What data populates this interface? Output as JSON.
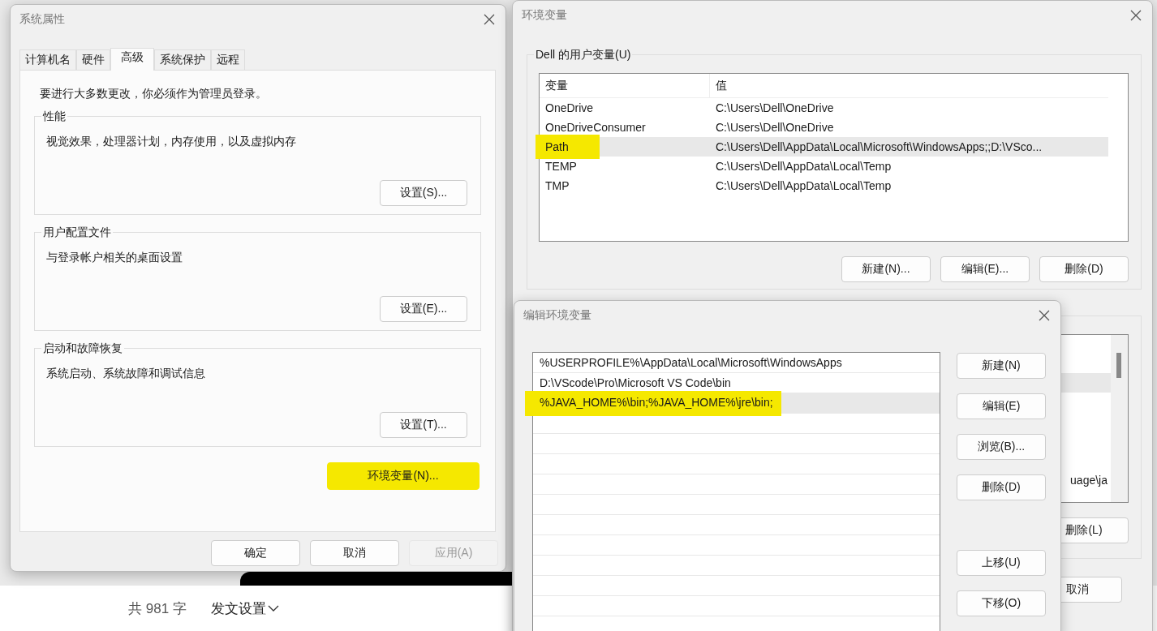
{
  "page_footer": {
    "word_count": "共 981 字",
    "publish_settings": "发文设置"
  },
  "system_properties": {
    "title": "系统属性",
    "tabs": [
      {
        "label": "计算机名",
        "selected": false
      },
      {
        "label": "硬件",
        "selected": false
      },
      {
        "label": "高级",
        "selected": true
      },
      {
        "label": "系统保护",
        "selected": false
      },
      {
        "label": "远程",
        "selected": false
      }
    ],
    "admin_note": "要进行大多数更改，你必须作为管理员登录。",
    "groups": [
      {
        "title": "性能",
        "description": "视觉效果，处理器计划，内存使用，以及虚拟内存",
        "button": "设置(S)..."
      },
      {
        "title": "用户配置文件",
        "description": "与登录帐户相关的桌面设置",
        "button": "设置(E)..."
      },
      {
        "title": "启动和故障恢复",
        "description": "系统启动、系统故障和调试信息",
        "button": "设置(T)..."
      }
    ],
    "env_button": {
      "label": "环境变量(N)...",
      "highlighted": true
    },
    "buttons": [
      {
        "label": "确定",
        "disabled": false
      },
      {
        "label": "取消",
        "disabled": false
      },
      {
        "label": "应用(A)",
        "disabled": true
      }
    ]
  },
  "environment_variables": {
    "title": "环境变量",
    "user_group": "Dell 的用户变量(U)",
    "columns": [
      "变量",
      "值"
    ],
    "rows": [
      {
        "name": "OneDrive",
        "value": "C:\\Users\\Dell\\OneDrive",
        "selected": false,
        "highlighted": false
      },
      {
        "name": "OneDriveConsumer",
        "value": "C:\\Users\\Dell\\OneDrive",
        "selected": false,
        "highlighted": false
      },
      {
        "name": "Path",
        "value": "C:\\Users\\Dell\\AppData\\Local\\Microsoft\\WindowsApps;;D:\\VSco...",
        "selected": true,
        "highlighted": true
      },
      {
        "name": "TEMP",
        "value": "C:\\Users\\Dell\\AppData\\Local\\Temp",
        "selected": false,
        "highlighted": false
      },
      {
        "name": "TMP",
        "value": "C:\\Users\\Dell\\AppData\\Local\\Temp",
        "selected": false,
        "highlighted": false
      }
    ],
    "user_buttons": [
      "新建(N)...",
      "编辑(E)...",
      "删除(D)"
    ],
    "system_rows": [
      {
        "selected": false
      },
      {
        "selected": true
      },
      {
        "selected": false
      },
      {
        "selected": false
      },
      {
        "selected": false
      },
      {
        "selected": false
      },
      {
        "selected": false,
        "value": "uage\\ja"
      }
    ],
    "system_buttons": [
      "删除(L)"
    ],
    "buttons": [
      "取消"
    ]
  },
  "edit_variable": {
    "title": "编辑环境变量",
    "entries": [
      {
        "text": "%USERPROFILE%\\AppData\\Local\\Microsoft\\WindowsApps",
        "selected": false,
        "highlighted": false
      },
      {
        "text": "D:\\VScode\\Pro\\Microsoft VS Code\\bin",
        "selected": false,
        "highlighted": false
      },
      {
        "text": "%JAVA_HOME%\\bin;%JAVA_HOME%\\jre\\bin;",
        "selected": true,
        "highlighted": true
      }
    ],
    "buttons": [
      "新建(N)",
      "编辑(E)",
      "浏览(B)...",
      "删除(D)"
    ],
    "move_buttons": [
      "上移(U)",
      "下移(O)"
    ]
  }
}
